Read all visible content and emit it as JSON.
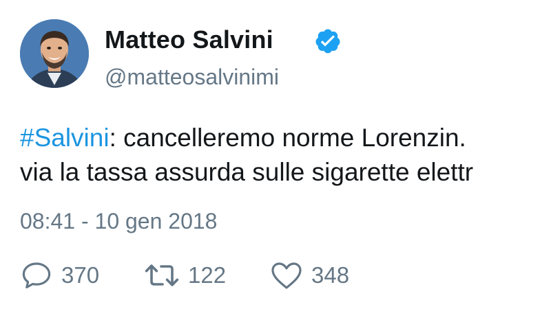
{
  "tweet": {
    "author": {
      "name": "Matteo Salvini",
      "handle": "@matteosalvinimi",
      "verified": true
    },
    "text": {
      "hashtag": "#Salvini",
      "line1_rest": ": cancelleremo norme Lorenzin. ",
      "line2": "via la tassa assurda sulle sigarette elettr"
    },
    "timestamp": "08:41 - 10 gen 2018",
    "actions": {
      "replies": "370",
      "retweets": "122",
      "likes": "348"
    }
  },
  "colors": {
    "text": "#14171a",
    "secondary": "#657786",
    "link": "#1b95e0",
    "verified_badge": "#1da1f2"
  },
  "icons": {
    "reply": "reply-icon",
    "retweet": "retweet-icon",
    "like": "heart-icon",
    "verified": "verified-badge-icon",
    "avatar": "avatar"
  }
}
